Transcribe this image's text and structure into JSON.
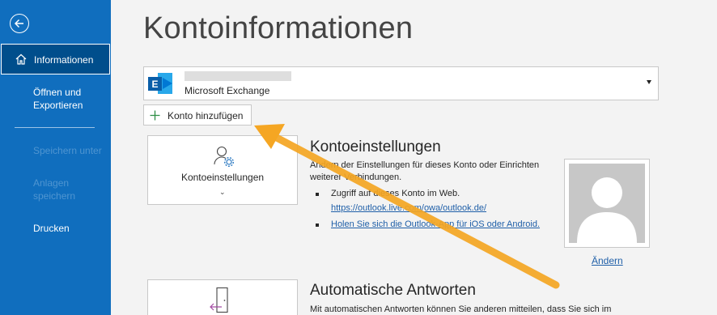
{
  "sidebar": {
    "back_icon": "back-arrow-icon",
    "items": [
      {
        "label": "Informationen",
        "icon": "home-icon",
        "active": true
      },
      {
        "label": "Öffnen und Exportieren"
      },
      {
        "label": "Speichern unter",
        "disabled": true
      },
      {
        "label": "Anlagen speichern",
        "disabled": true
      },
      {
        "label": "Drucken"
      }
    ],
    "open_line1": "Öffnen und",
    "open_line2": "Exportieren",
    "attach_line1": "Anlagen",
    "attach_line2": "speichern",
    "bg_color": "#106ebe"
  },
  "main": {
    "title": "Kontoinformationen",
    "account": {
      "type": "Microsoft Exchange",
      "icon": "exchange-icon"
    },
    "add_account_label": "Konto hinzufügen",
    "account_settings": {
      "tile_label": "Kontoeinstellungen",
      "title": "Kontoeinstellungen",
      "desc_line1": "Ändern der Einstellungen für dieses Konto oder Einrichten",
      "desc_line2": "weiterer Verbindungen.",
      "bullet1": "Zugriff auf dieses Konto im Web.",
      "link1": "https://outlook.live.com/owa/outlook.de/",
      "link2": "Holen Sie sich die Outlook-App für iOS oder Android."
    },
    "photo": {
      "change_label": "Ändern"
    },
    "auto_replies": {
      "title": "Automatische Antworten",
      "desc": "Mit automatischen Antworten können Sie anderen mitteilen, dass Sie sich im"
    }
  },
  "colors": {
    "accent": "#106ebe",
    "active_nav": "#004e8c",
    "link": "#1f5fa8",
    "annotation_arrow": "#f5a623"
  }
}
